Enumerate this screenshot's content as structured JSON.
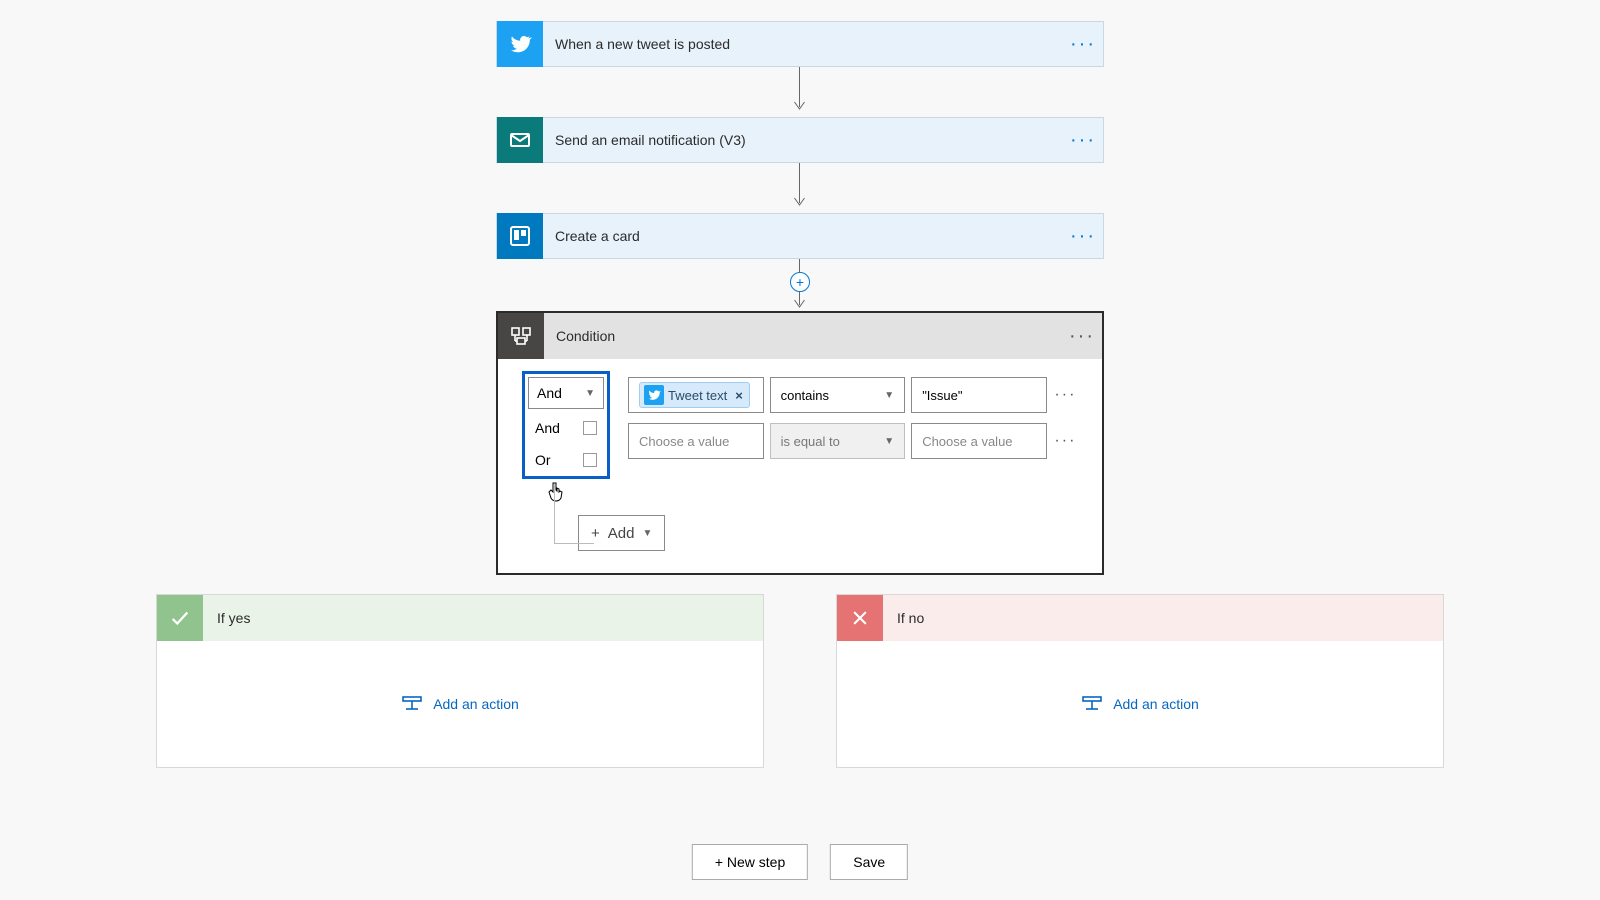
{
  "steps": [
    {
      "label": "When a new tweet is posted"
    },
    {
      "label": "Send an email notification (V3)"
    },
    {
      "label": "Create a card"
    }
  ],
  "condition": {
    "title": "Condition",
    "logic_selected": "And",
    "logic_options": [
      "And",
      "Or"
    ],
    "rows": [
      {
        "left_token": "Tweet text",
        "operator": "contains",
        "right": "\"Issue\""
      },
      {
        "left_placeholder": "Choose a value",
        "operator": "is equal to",
        "right_placeholder": "Choose a value"
      }
    ],
    "add_label": "Add"
  },
  "branches": {
    "yes": {
      "label": "If yes",
      "action": "Add an action"
    },
    "no": {
      "label": "If no",
      "action": "Add an action"
    }
  },
  "buttons": {
    "new_step": "+ New step",
    "save": "Save"
  }
}
